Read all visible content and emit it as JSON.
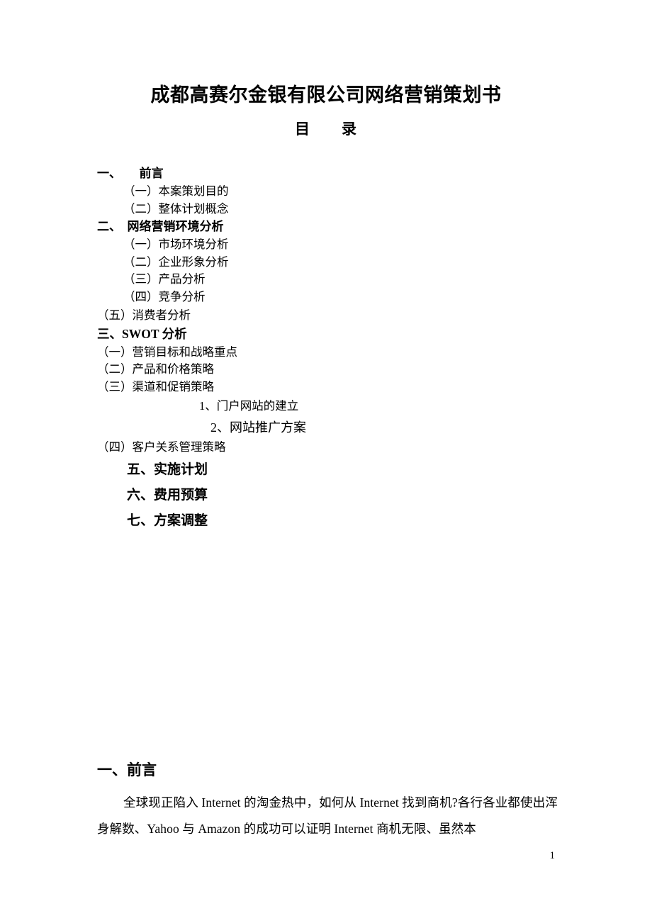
{
  "document": {
    "title": "成都高赛尔金银有限公司网络营销策划书",
    "subtitle": "目　　录",
    "page_number": "1"
  },
  "toc": {
    "items": [
      {
        "text": "一、　　前言",
        "style": "lvl1"
      },
      {
        "text": "（一）本案策划目的",
        "style": "sub sub-indent"
      },
      {
        "text": "（二）整体计划概念",
        "style": "sub sub-indent"
      },
      {
        "text": "二、　网络营销环境分析",
        "style": "lvl1"
      },
      {
        "text": "（一）市场环境分析",
        "style": "sub sub-indent"
      },
      {
        "text": "（二）企业形象分析",
        "style": "sub sub-indent"
      },
      {
        "text": "（三）产品分析",
        "style": "sub sub-indent"
      },
      {
        "text": "（四）竞争分析",
        "style": "sub sub-indent sp-after-four"
      },
      {
        "text": "（五）消费者分析",
        "style": "sub sub-flush"
      },
      {
        "text": "三、SWOT 分析",
        "style": "swot"
      },
      {
        "text": "（一）营销目标和战略重点",
        "style": "sub sub-flush"
      },
      {
        "text": "（二）产品和价格策略",
        "style": "sub sub-flush"
      },
      {
        "text": "（三）渠道和促销策略",
        "style": "sub sub-flush"
      },
      {
        "text": "1、门户网站的建立",
        "style": "num1"
      },
      {
        "text": "2、网站推广方案",
        "style": "num2"
      },
      {
        "text": "（四）客户关系管理策略",
        "style": "sub sub-flush"
      },
      {
        "text": "五、实施计划",
        "style": "big"
      },
      {
        "text": "六、费用预算",
        "style": "big"
      },
      {
        "text": "七、方案调整",
        "style": "big"
      }
    ]
  },
  "body": {
    "heading": "一、前言",
    "paragraph": "全球现正陷入 Internet 的淘金热中，如何从 Internet 找到商机?各行各业都使出浑身解数、Yahoo 与 Amazon 的成功可以证明 Internet 商机无限、虽然本"
  }
}
